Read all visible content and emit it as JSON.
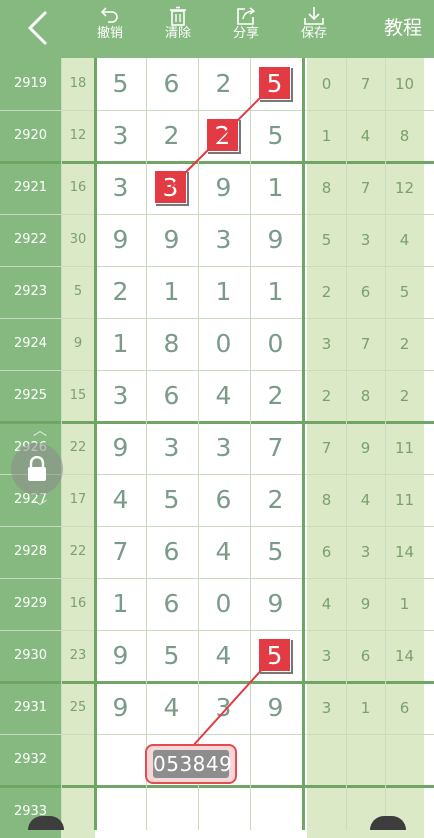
{
  "toolbar": {
    "undo_label": "撤销",
    "clear_label": "清除",
    "share_label": "分享",
    "save_label": "保存",
    "tutorial_label": "教程"
  },
  "rows": [
    {
      "issue": "2919",
      "sum": "18",
      "digits": [
        "5",
        "6",
        "2",
        "5"
      ],
      "side": [
        "0",
        "7",
        "10"
      ]
    },
    {
      "issue": "2920",
      "sum": "12",
      "digits": [
        "3",
        "2",
        "2",
        "5"
      ],
      "side": [
        "1",
        "4",
        "8"
      ]
    },
    {
      "issue": "2921",
      "sum": "16",
      "digits": [
        "3",
        "3",
        "9",
        "1"
      ],
      "side": [
        "8",
        "7",
        "12"
      ]
    },
    {
      "issue": "2922",
      "sum": "30",
      "digits": [
        "9",
        "9",
        "3",
        "9"
      ],
      "side": [
        "5",
        "3",
        "4"
      ]
    },
    {
      "issue": "2923",
      "sum": "5",
      "digits": [
        "2",
        "1",
        "1",
        "1"
      ],
      "side": [
        "2",
        "6",
        "5"
      ]
    },
    {
      "issue": "2924",
      "sum": "9",
      "digits": [
        "1",
        "8",
        "0",
        "0"
      ],
      "side": [
        "3",
        "7",
        "2"
      ]
    },
    {
      "issue": "2925",
      "sum": "15",
      "digits": [
        "3",
        "6",
        "4",
        "2"
      ],
      "side": [
        "2",
        "8",
        "2"
      ]
    },
    {
      "issue": "2926",
      "sum": "22",
      "digits": [
        "9",
        "3",
        "3",
        "7"
      ],
      "side": [
        "7",
        "9",
        "11"
      ]
    },
    {
      "issue": "2927",
      "sum": "17",
      "digits": [
        "4",
        "5",
        "6",
        "2"
      ],
      "side": [
        "8",
        "4",
        "11"
      ]
    },
    {
      "issue": "2928",
      "sum": "22",
      "digits": [
        "7",
        "6",
        "4",
        "5"
      ],
      "side": [
        "6",
        "3",
        "14"
      ]
    },
    {
      "issue": "2929",
      "sum": "16",
      "digits": [
        "1",
        "6",
        "0",
        "9"
      ],
      "side": [
        "4",
        "9",
        "1"
      ]
    },
    {
      "issue": "2930",
      "sum": "23",
      "digits": [
        "9",
        "5",
        "4",
        "5"
      ],
      "side": [
        "3",
        "6",
        "14"
      ]
    },
    {
      "issue": "2931",
      "sum": "25",
      "digits": [
        "9",
        "4",
        "3",
        "9"
      ],
      "side": [
        "3",
        "1",
        "6"
      ]
    },
    {
      "issue": "2932",
      "sum": "",
      "digits": [
        "",
        "",
        "",
        ""
      ],
      "side": [
        "",
        "",
        ""
      ]
    },
    {
      "issue": "2933",
      "sum": "",
      "digits": [
        "",
        "",
        "",
        ""
      ],
      "side": [
        "",
        "",
        ""
      ]
    }
  ],
  "highlights": [
    {
      "row": 0,
      "col": 3
    },
    {
      "row": 1,
      "col": 2
    },
    {
      "row": 2,
      "col": 1
    },
    {
      "row": 11,
      "col": 3
    }
  ],
  "input_box": {
    "value": "053849"
  },
  "colors": {
    "header": "#86b980",
    "side_bg": "#dbe9c7",
    "highlight": "#e23b44",
    "trend_line": "#e23b44"
  },
  "icons": [
    "back-arrow-icon",
    "undo-icon",
    "trash-icon",
    "share-icon",
    "save-icon",
    "lock-icon"
  ]
}
